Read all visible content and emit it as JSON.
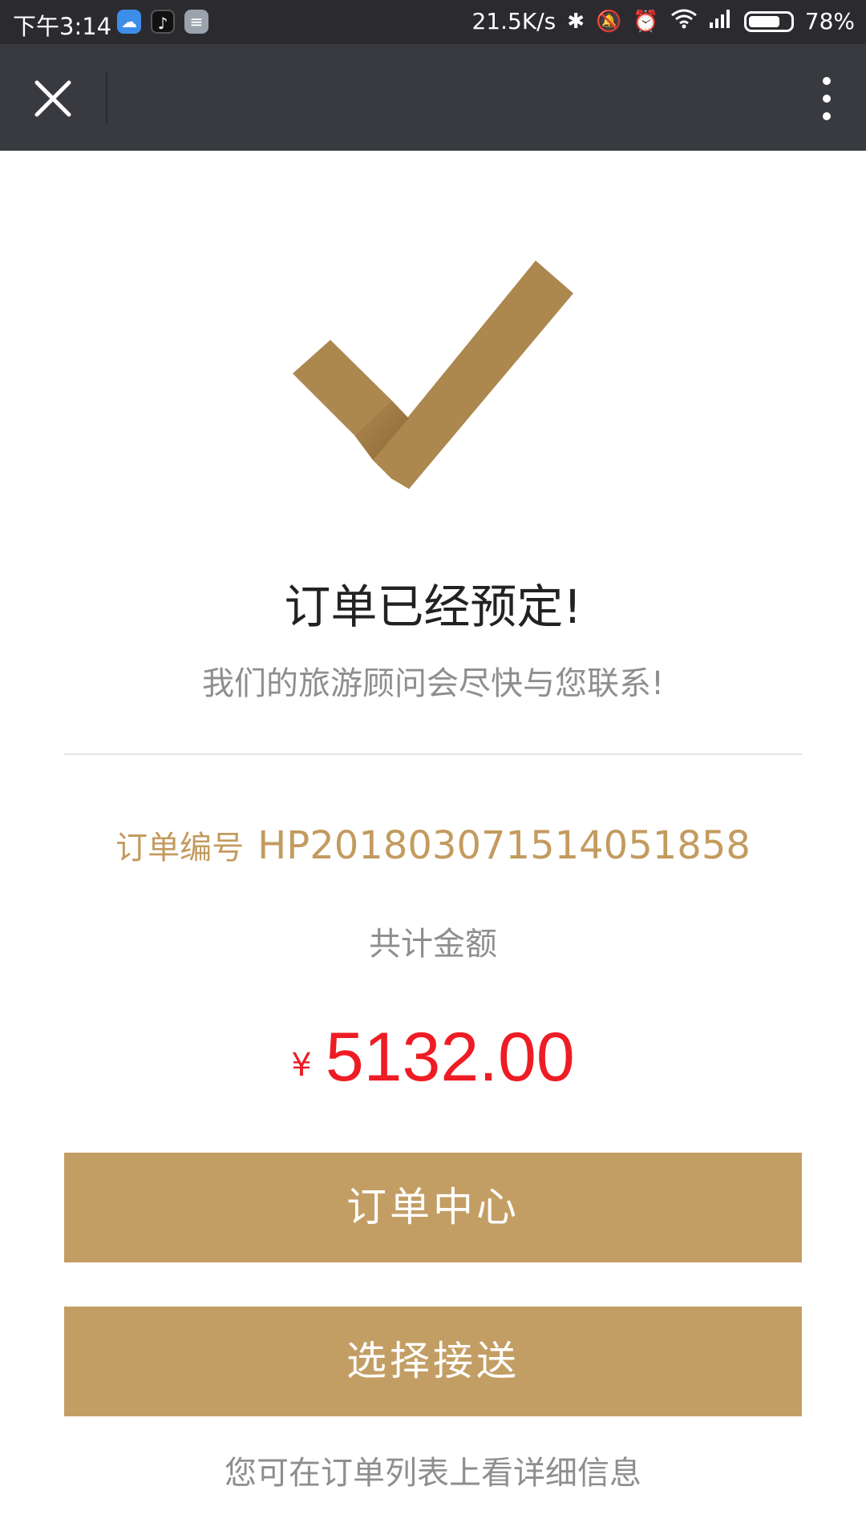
{
  "status_bar": {
    "time": "下午3:14",
    "net_speed": "21.5K/s",
    "battery_pct": "78%",
    "battery_level": 0.78,
    "icons": [
      "cloud-app-icon",
      "tiktok-app-icon",
      "notes-app-icon",
      "bluetooth-icon",
      "mute-icon",
      "alarm-icon",
      "wifi-icon",
      "signal-icon",
      "battery-icon"
    ]
  },
  "title_bar": {
    "close_icon": "close-icon",
    "more_icon": "more-vertical-icon"
  },
  "result": {
    "icon": "checkmark-icon",
    "title": "订单已经预定!",
    "subtitle": "我们的旅游顾问会尽快与您联系!",
    "order_label": "订单编号",
    "order_number": "HP20180307151405185​8",
    "total_label": "共计金额",
    "currency": "¥",
    "amount": "5132.00"
  },
  "buttons": {
    "order_center": "订单中心",
    "select_transfer": "选择接送"
  },
  "footer_note": "您可在订单列表上看详细信息",
  "colors": {
    "accent_gold": "#c39e64",
    "amount_red": "#ee1c24",
    "title_bar": "#393a3f"
  }
}
